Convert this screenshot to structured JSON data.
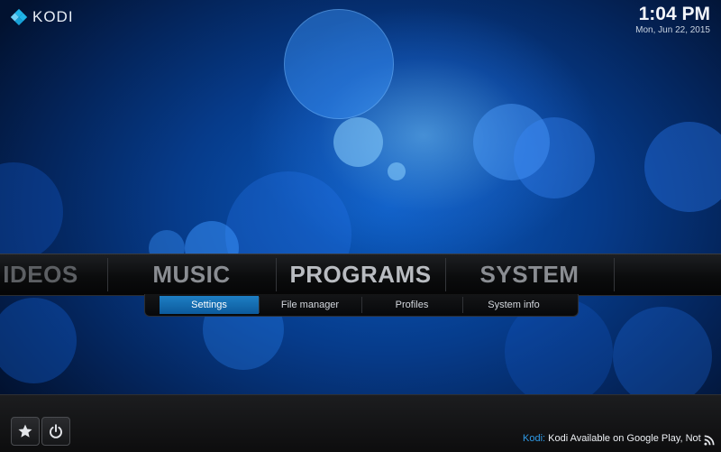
{
  "app": {
    "logo_text": "KODI"
  },
  "clock": {
    "time": "1:04 PM",
    "date": "Mon, Jun 22, 2015"
  },
  "main_menu": {
    "items": [
      {
        "label": "IDEOS"
      },
      {
        "label": "MUSIC"
      },
      {
        "label": "PROGRAMS"
      },
      {
        "label": "SYSTEM"
      }
    ],
    "active": "PROGRAMS"
  },
  "sub_menu": {
    "items": [
      {
        "label": "Settings",
        "active": true
      },
      {
        "label": "File manager",
        "active": false
      },
      {
        "label": "Profiles",
        "active": false
      },
      {
        "label": "System info",
        "active": false
      }
    ]
  },
  "footer": {
    "buttons": [
      {
        "icon": "star-icon"
      },
      {
        "icon": "power-icon"
      }
    ],
    "rss": {
      "source": "Kodi:",
      "message": "Kodi Available on Google Play, Not o"
    }
  },
  "colors": {
    "accent": "#1e7fc4",
    "background": "#063b8a",
    "ticker_source": "#2f9be8"
  }
}
